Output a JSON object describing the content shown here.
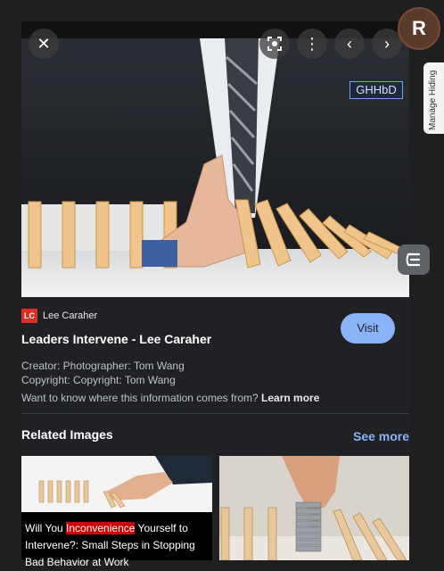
{
  "image_tag": "GHHbD",
  "extension": {
    "logo_letter": "R",
    "tab_label": "Manage Hiding"
  },
  "source": {
    "favicon_text": "LC",
    "name": "Lee Caraher"
  },
  "result": {
    "title": "Leaders Intervene - Lee Caraher",
    "visit_label": "Visit",
    "creator": "Creator: Photographer: Tom Wang",
    "copyright": "Copyright: Copyright: Tom Wang",
    "info_question": "Want to know where this information comes from?",
    "learn_more": "Learn more"
  },
  "related": {
    "heading": "Related Images",
    "see_more": "See more",
    "items": [
      {
        "caption_pre": "Will You ",
        "caption_highlight": "Inconvenience",
        "caption_post": " Yourself to Intervene?: Small Steps in Stopping Bad Behavior at Work"
      }
    ]
  },
  "icons": [
    "close-icon",
    "lens-icon",
    "more-vert-icon",
    "chevron-left-icon",
    "chevron-right-icon",
    "sidebar-toggle-icon"
  ],
  "colors": {
    "accent": "#8ab4f8",
    "highlight": "#d00000",
    "favicon": "#d93025"
  }
}
